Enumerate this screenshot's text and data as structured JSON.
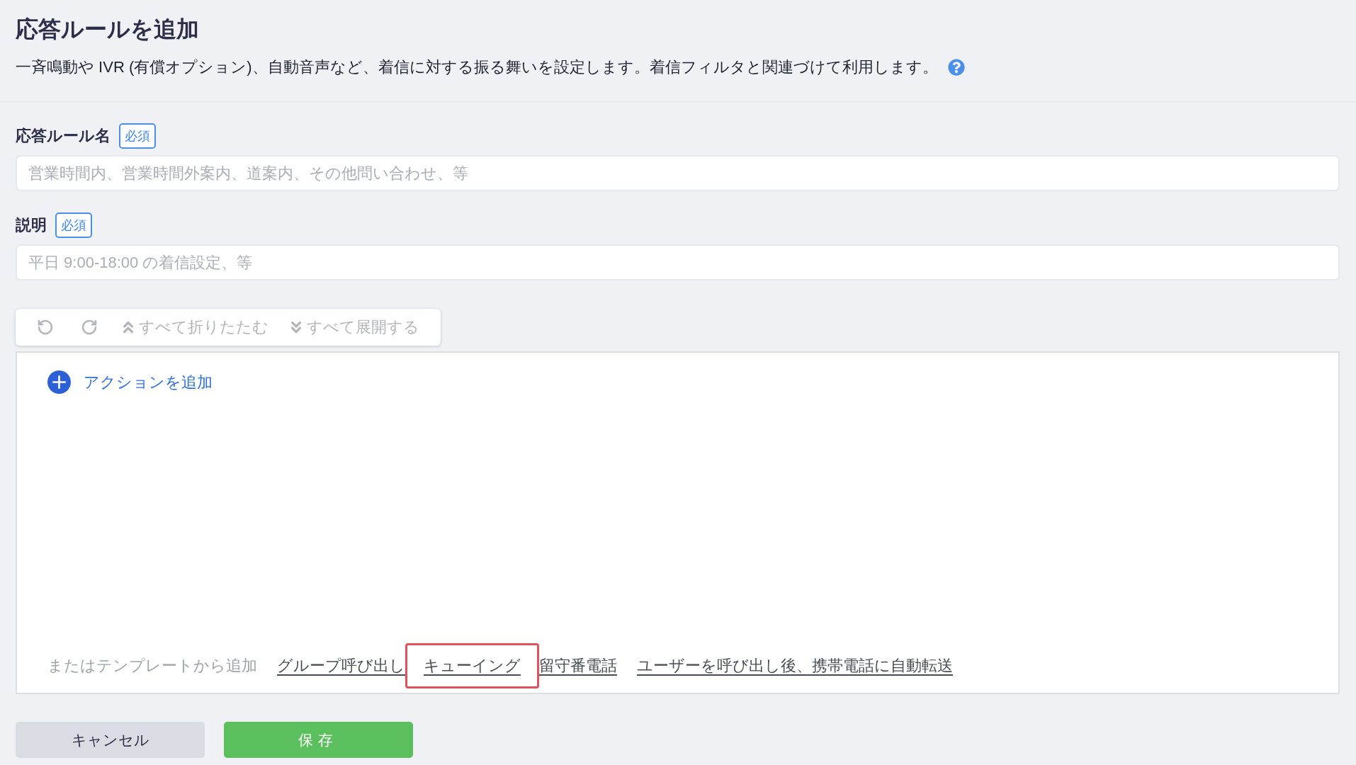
{
  "page": {
    "title": "応答ルールを追加",
    "description": "一斉鳴動や IVR (有償オプション)、自動音声など、着信に対する振る舞いを設定します。着信フィルタと関連づけて利用します。"
  },
  "fields": [
    {
      "label": "応答ルール名",
      "badge": "必須",
      "placeholder": "営業時間内、営業時間外案内、道案内、その他問い合わせ、等"
    },
    {
      "label": "説明",
      "badge": "必須",
      "placeholder": "平日 9:00-18:00 の着信設定、等"
    }
  ],
  "toolbar": [
    {
      "kind": "undo",
      "disabled": true
    },
    {
      "kind": "redo",
      "disabled": true
    },
    {
      "kind": "collapse",
      "label": "すべて折りたたむ",
      "disabled": true
    },
    {
      "kind": "expand",
      "label": "すべて展開する",
      "disabled": true
    }
  ],
  "actions": {
    "add_label": "アクションを追加",
    "template_intro": "またはテンプレートから追加",
    "templates": [
      {
        "label": "グループ呼び出し",
        "highlighted": false
      },
      {
        "label": "キューイング",
        "highlighted": true
      },
      {
        "label": "留守番電話",
        "highlighted": false
      },
      {
        "label": "ユーザーを呼び出し後、携帯電話に自動転送",
        "highlighted": false
      }
    ]
  },
  "buttons": [
    {
      "kind": "cancel",
      "label": "キャンセル"
    },
    {
      "kind": "save",
      "label": "保存"
    }
  ]
}
